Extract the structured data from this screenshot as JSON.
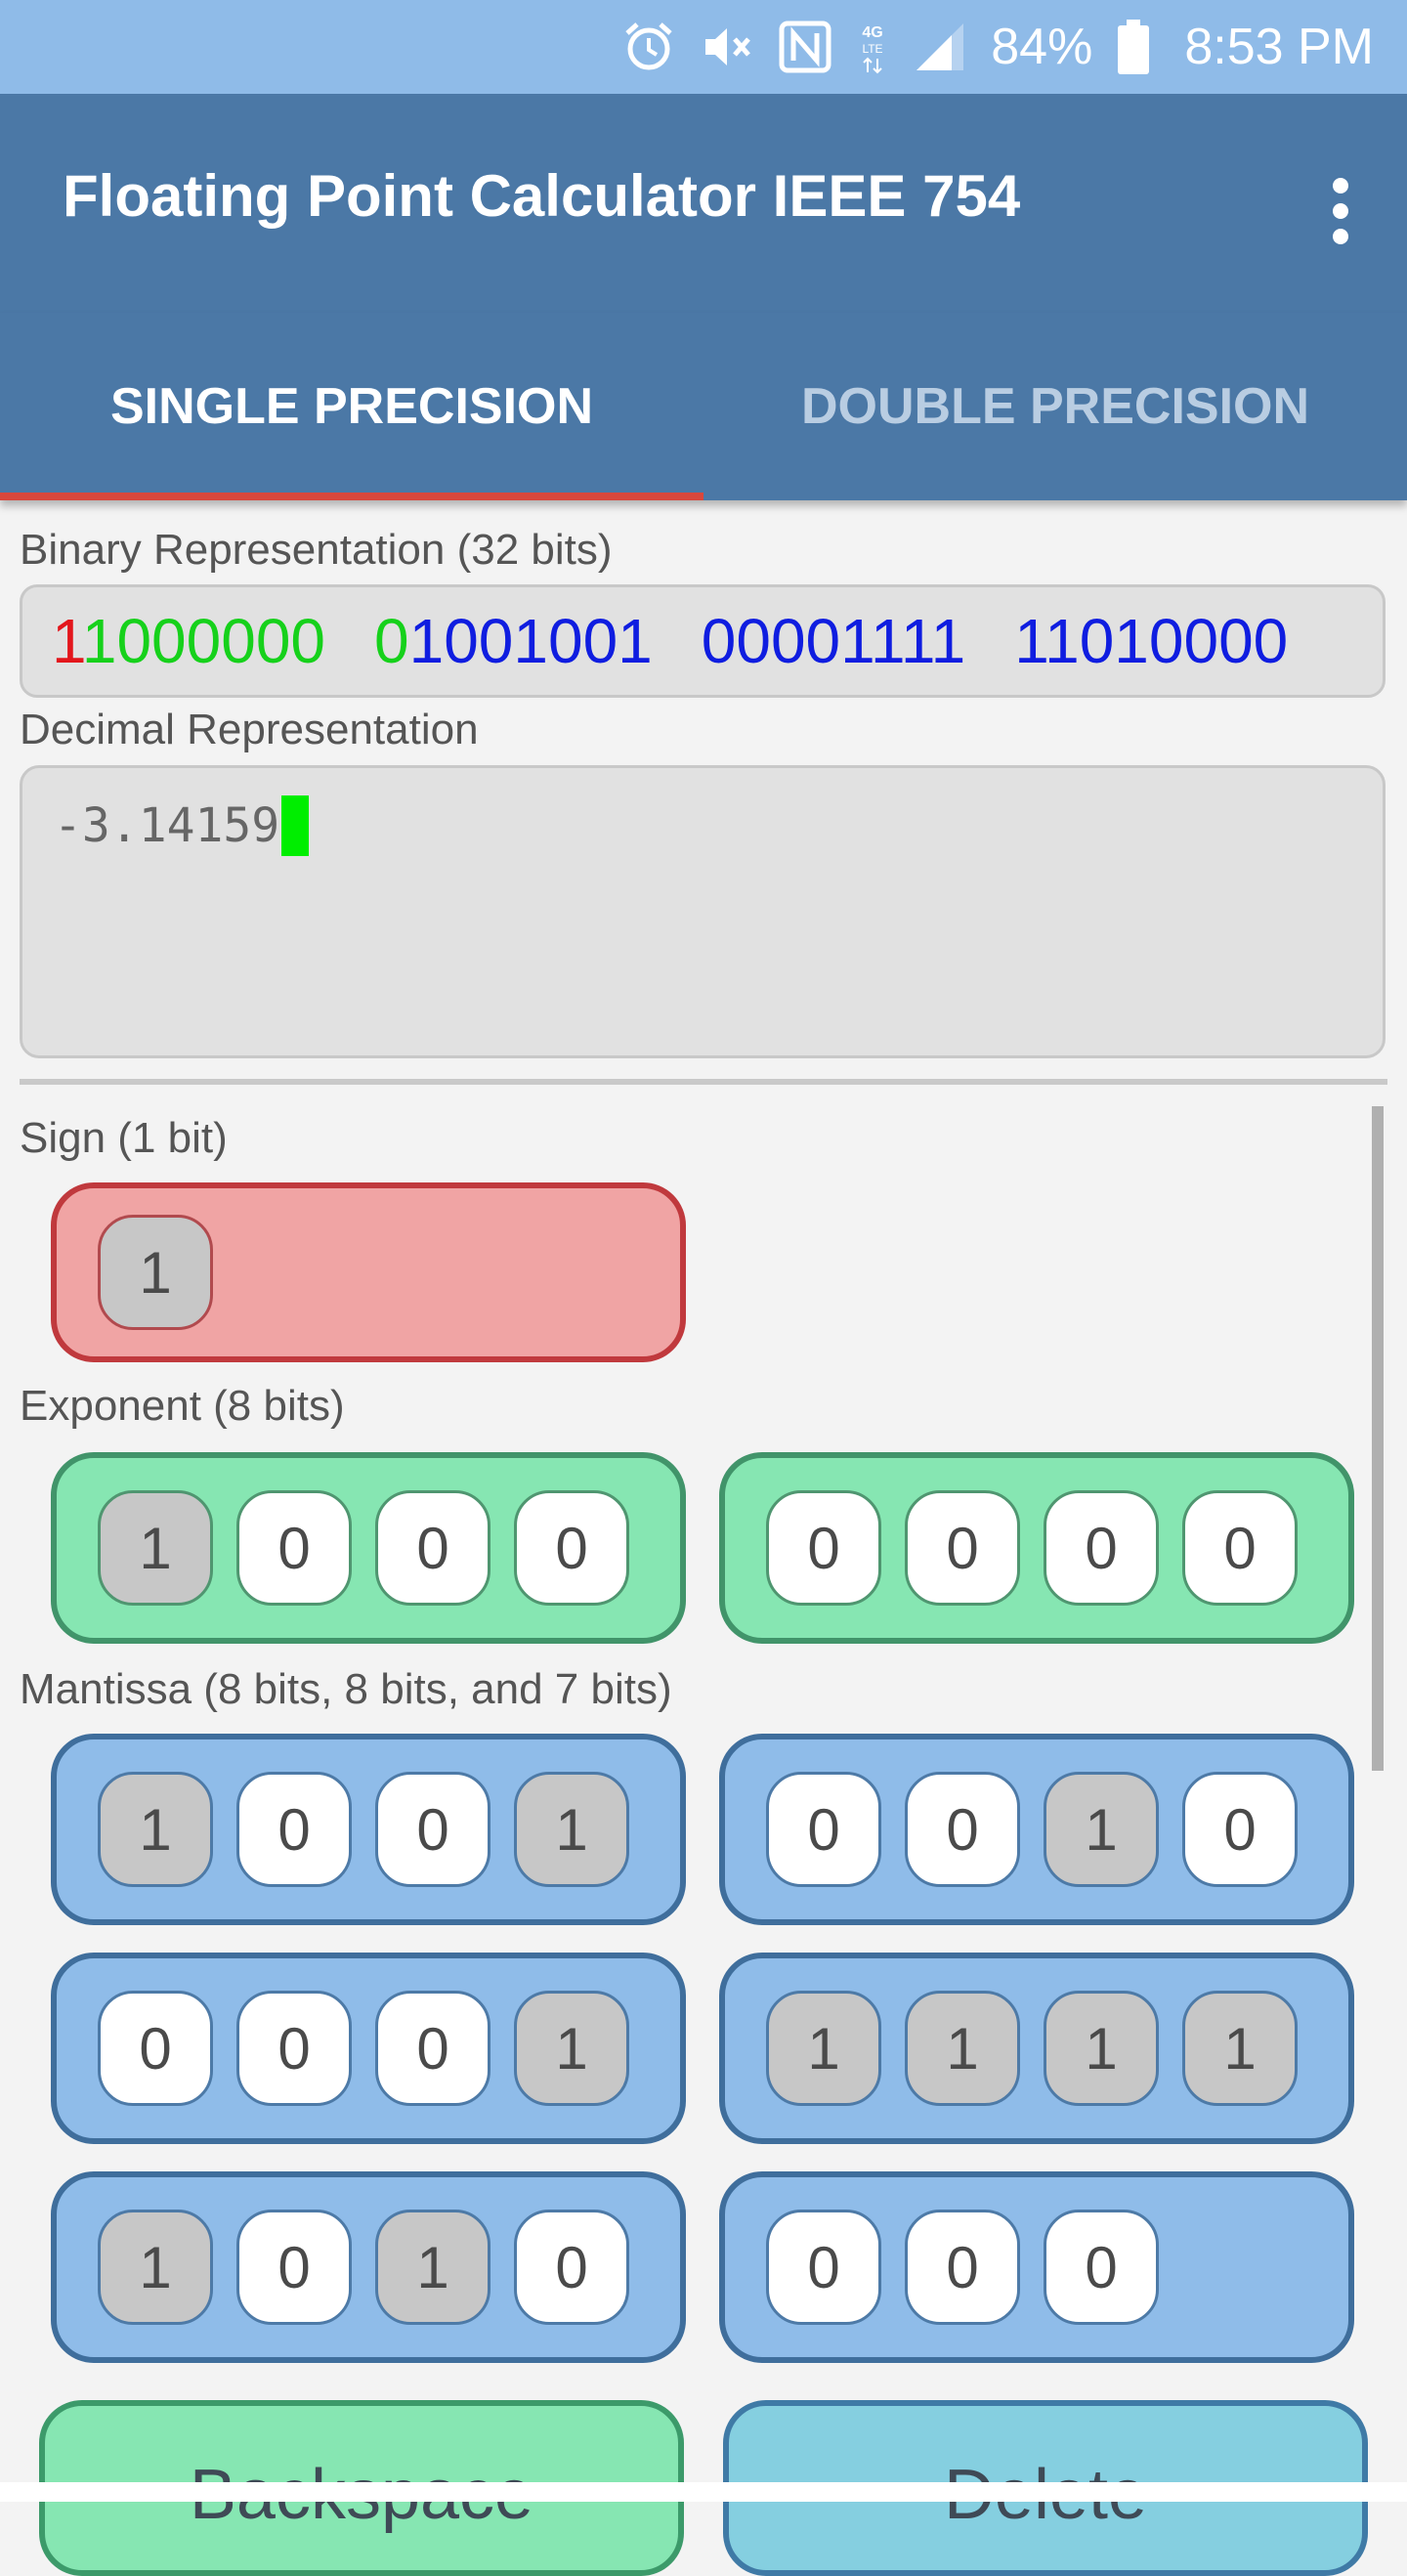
{
  "status_bar": {
    "network": "4G LTE",
    "battery": "84%",
    "time": "8:53 PM",
    "icons": [
      "alarm-icon",
      "mute-icon",
      "nfc-icon",
      "lte-icon",
      "signal-icon",
      "battery-icon"
    ]
  },
  "app": {
    "title": "Floating Point Calculator IEEE 754",
    "menu_icon": "more-vert-icon"
  },
  "tabs": [
    {
      "label": "SINGLE PRECISION",
      "active": true
    },
    {
      "label": "DOUBLE PRECISION",
      "active": false
    }
  ],
  "binary": {
    "label": "Binary Representation (32 bits)",
    "groups": [
      {
        "parts": [
          {
            "text": "1",
            "color": "#e3161c"
          },
          {
            "text": "1000000",
            "color": "#16d11b"
          }
        ]
      },
      {
        "parts": [
          {
            "text": "0",
            "color": "#16d11b"
          },
          {
            "text": "1001001",
            "color": "#0f1de0"
          }
        ]
      },
      {
        "parts": [
          {
            "text": "00001111",
            "color": "#0f1de0"
          }
        ]
      },
      {
        "parts": [
          {
            "text": "11010000",
            "color": "#0f1de0"
          }
        ]
      }
    ]
  },
  "decimal": {
    "label": "Decimal Representation",
    "value": "-3.14159"
  },
  "sign": {
    "label": "Sign (1 bit)",
    "bits": [
      "1"
    ]
  },
  "exponent": {
    "label": "Exponent (8 bits)",
    "nibbles": [
      [
        "1",
        "0",
        "0",
        "0"
      ],
      [
        "0",
        "0",
        "0",
        "0"
      ]
    ]
  },
  "mantissa": {
    "label": "Mantissa (8 bits, 8 bits, and 7 bits)",
    "nibbles": [
      [
        "1",
        "0",
        "0",
        "1"
      ],
      [
        "0",
        "0",
        "1",
        "0"
      ],
      [
        "0",
        "0",
        "0",
        "1"
      ],
      [
        "1",
        "1",
        "1",
        "1"
      ],
      [
        "1",
        "0",
        "1",
        "0"
      ],
      [
        "0",
        "0",
        "0"
      ]
    ]
  },
  "buttons": {
    "backspace": "Backspace",
    "delete": "Delete"
  },
  "colors": {
    "app_bar": "#4b78a6",
    "status_bar": "#8fbbe8",
    "tab_indicator": "#d9473c",
    "sign_fill": "#f0a4a4",
    "exponent_fill": "#86e6b2",
    "mantissa_fill": "#8fbce9",
    "cursor": "#00ee00"
  }
}
